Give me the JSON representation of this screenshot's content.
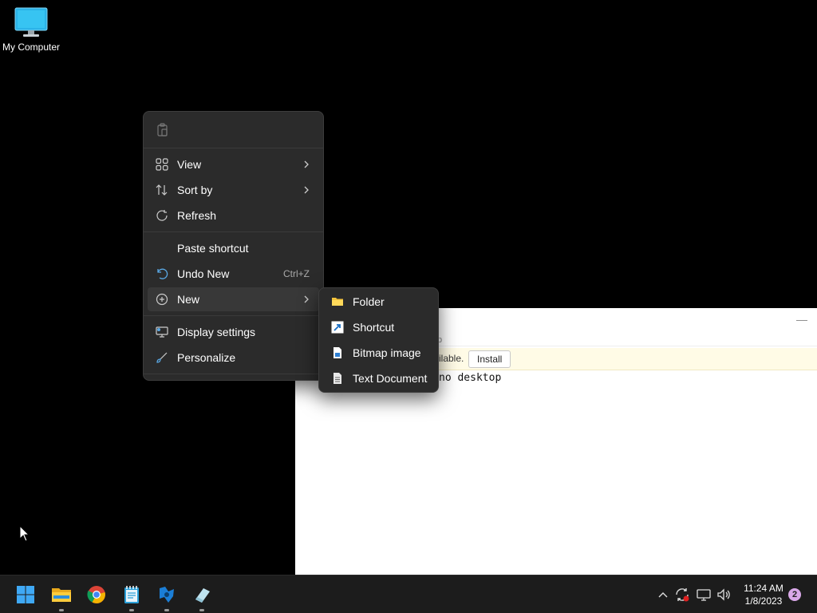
{
  "desktop": {
    "icon_label": "My Computer"
  },
  "app_window": {
    "hint_text": "p",
    "banner_text": "ilable.",
    "install_label": "Install",
    "content_text": "no desktop",
    "minimize_glyph": "—"
  },
  "context_menu": {
    "items": [
      {
        "label": "View",
        "icon": "view-grid-icon",
        "has_submenu": true
      },
      {
        "label": "Sort by",
        "icon": "sort-icon",
        "has_submenu": true
      },
      {
        "label": "Refresh",
        "icon": "refresh-icon",
        "has_submenu": false
      },
      {
        "label": "Paste shortcut",
        "icon": "",
        "has_submenu": false
      },
      {
        "label": "Undo New",
        "icon": "undo-icon",
        "shortcut": "Ctrl+Z"
      },
      {
        "label": "New",
        "icon": "new-plus-icon",
        "has_submenu": true,
        "active": true
      },
      {
        "label": "Display settings",
        "icon": "display-settings-icon"
      },
      {
        "label": "Personalize",
        "icon": "personalize-brush-icon"
      }
    ]
  },
  "new_submenu": {
    "items": [
      {
        "label": "Folder",
        "icon": "folder-icon"
      },
      {
        "label": "Shortcut",
        "icon": "shortcut-icon"
      },
      {
        "label": "Bitmap image",
        "icon": "bitmap-image-icon"
      },
      {
        "label": "Text Document",
        "icon": "text-document-icon"
      }
    ]
  },
  "taskbar": {
    "apps": [
      {
        "name": "start-button",
        "running": false
      },
      {
        "name": "file-explorer",
        "running": true
      },
      {
        "name": "chrome",
        "running": false
      },
      {
        "name": "notepad",
        "running": true
      },
      {
        "name": "app-blue",
        "running": true
      },
      {
        "name": "app-eraser",
        "running": true
      }
    ],
    "time": "11:24 AM",
    "date": "1/8/2023",
    "notification_count": "2"
  },
  "colors": {
    "desktop_bg": "#000000",
    "menu_bg": "#2b2b2b",
    "taskbar_bg": "#1c1c1c",
    "accent": "#0078d4"
  }
}
